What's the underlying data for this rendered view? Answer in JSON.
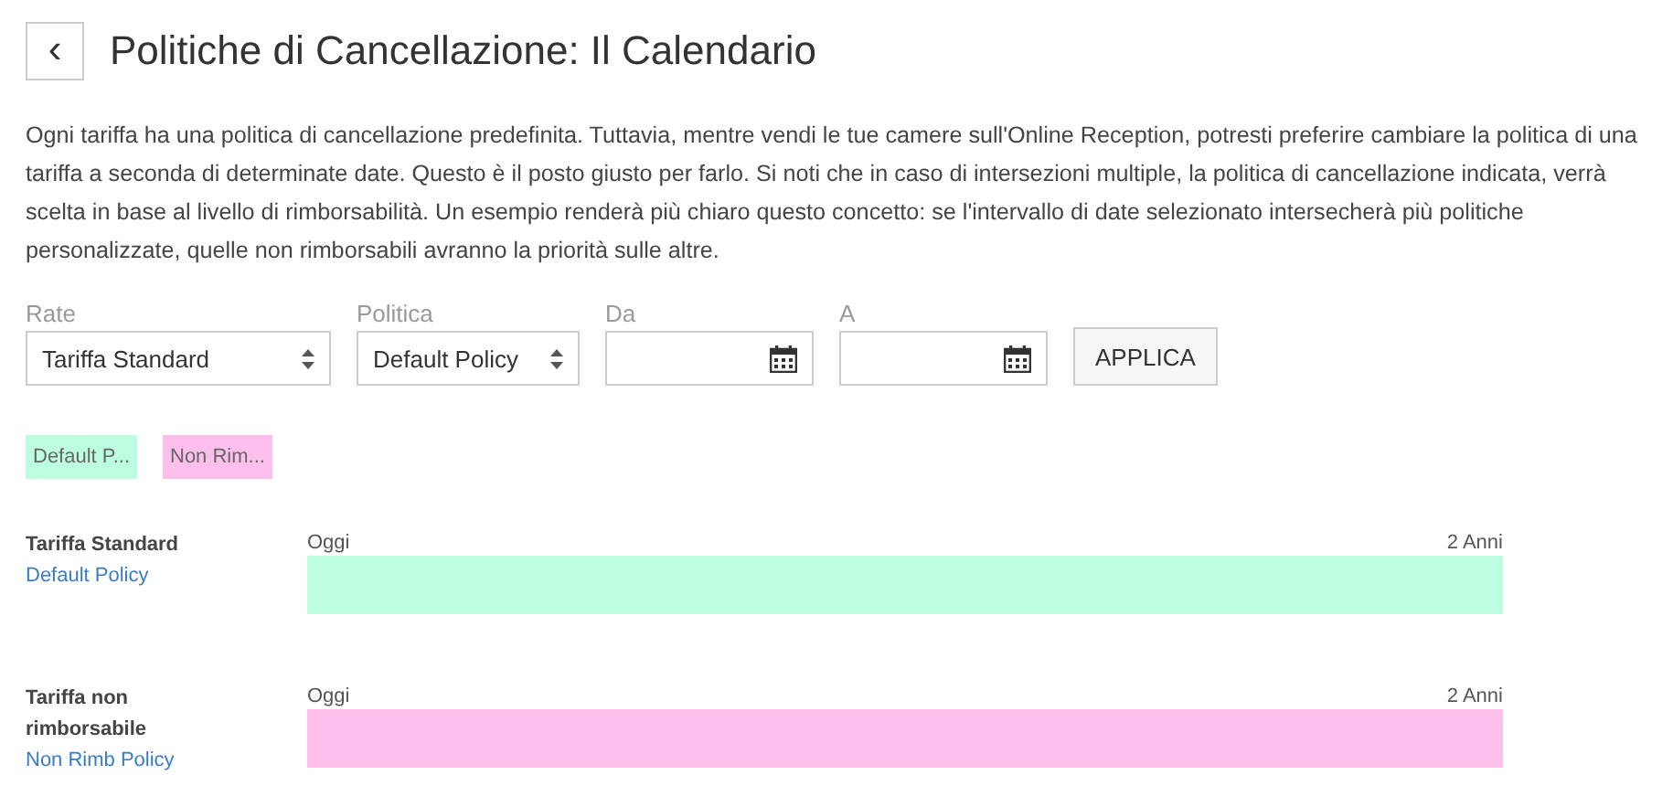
{
  "header": {
    "back_icon": "‹",
    "title": "Politiche di Cancellazione: Il Calendario"
  },
  "description": "Ogni tariffa ha una politica di cancellazione predefinita. Tuttavia, mentre vendi le tue camere sull'Online Reception, potresti preferire cambiare la politica di una tariffa a seconda di determinate date. Questo è il posto giusto per farlo. Si noti che in caso di intersezioni multiple, la politica di cancellazione indicata, verrà scelta in base al livello di rimborsabilità. Un esempio renderà più chiaro questo concetto: se l'intervallo di date selezionato intersecherà più politiche personalizzate, quelle non rimborsabili avranno la priorità sulle altre.",
  "filters": [
    {
      "kind": "select",
      "label": "Rate",
      "value": "Tariffa Standard"
    },
    {
      "kind": "select",
      "label": "Politica",
      "value": "Default Policy"
    },
    {
      "kind": "date",
      "label": "Da"
    },
    {
      "kind": "date",
      "label": "A"
    }
  ],
  "apply_button": "APPLICA",
  "legend": [
    {
      "label": "Default P...",
      "color": "#bdfde0"
    },
    {
      "label": "Non Rim...",
      "color": "#fdc0ec"
    }
  ],
  "timelines": [
    {
      "rate": "Tariffa Standard",
      "policy": "Default Policy",
      "start": "Oggi",
      "end": "2 Anni",
      "color": "#bdfde0"
    },
    {
      "rate": "Tariffa non rimborsabile",
      "policy": "Non Rimb Policy",
      "start": "Oggi",
      "end": "2 Anni",
      "color": "#fdc0ec"
    }
  ]
}
